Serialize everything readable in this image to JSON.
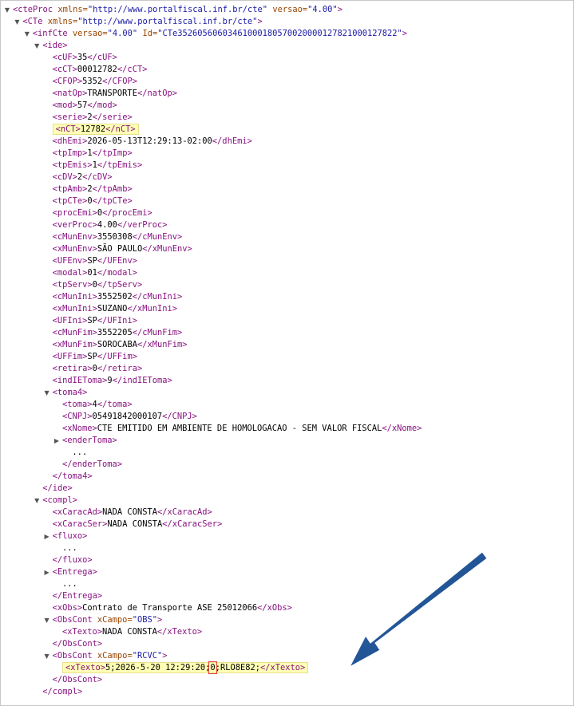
{
  "colors": {
    "tag": "#881280",
    "attr_name": "#994500",
    "attr_value": "#1a1aa6",
    "highlight": "#ffffb5",
    "red_box": "#e0403c",
    "arrow": "#1f4e8c"
  },
  "icons": {
    "expanded": "triangle-down-icon",
    "collapsed": "triangle-right-icon"
  },
  "lines": [
    {
      "depth": 0,
      "toggle": "expanded",
      "parts": [
        [
          "t",
          "<cteProc"
        ],
        [
          "s",
          " "
        ],
        [
          "a",
          "xmlns="
        ],
        [
          "v",
          "\"http://www.portalfiscal.inf.br/cte\""
        ],
        [
          "s",
          " "
        ],
        [
          "a",
          "versao="
        ],
        [
          "v",
          "\"4.00\""
        ],
        [
          "t",
          ">"
        ]
      ]
    },
    {
      "depth": 1,
      "toggle": "expanded",
      "parts": [
        [
          "t",
          "<CTe"
        ],
        [
          "s",
          " "
        ],
        [
          "a",
          "xmlns="
        ],
        [
          "v",
          "\"http://www.portalfiscal.inf.br/cte\""
        ],
        [
          "t",
          ">"
        ]
      ]
    },
    {
      "depth": 2,
      "toggle": "expanded",
      "parts": [
        [
          "t",
          "<infCte"
        ],
        [
          "s",
          " "
        ],
        [
          "a",
          "versao="
        ],
        [
          "v",
          "\"4.00\""
        ],
        [
          "s",
          " "
        ],
        [
          "a",
          "Id="
        ],
        [
          "v",
          "\"CTe35260560603461000180570020000127821000127822\""
        ],
        [
          "t",
          ">"
        ]
      ]
    },
    {
      "depth": 3,
      "toggle": "expanded",
      "parts": [
        [
          "t",
          "<ide>"
        ]
      ]
    },
    {
      "depth": 4,
      "parts": [
        [
          "t",
          "<cUF>"
        ],
        [
          "x",
          "35"
        ],
        [
          "t",
          "</cUF>"
        ]
      ]
    },
    {
      "depth": 4,
      "parts": [
        [
          "t",
          "<cCT>"
        ],
        [
          "x",
          "00012782"
        ],
        [
          "t",
          "</cCT>"
        ]
      ]
    },
    {
      "depth": 4,
      "parts": [
        [
          "t",
          "<CFOP>"
        ],
        [
          "x",
          "5352"
        ],
        [
          "t",
          "</CFOP>"
        ]
      ]
    },
    {
      "depth": 4,
      "parts": [
        [
          "t",
          "<natOp>"
        ],
        [
          "x",
          "TRANSPORTE"
        ],
        [
          "t",
          "</natOp>"
        ]
      ]
    },
    {
      "depth": 4,
      "parts": [
        [
          "t",
          "<mod>"
        ],
        [
          "x",
          "57"
        ],
        [
          "t",
          "</mod>"
        ]
      ]
    },
    {
      "depth": 4,
      "parts": [
        [
          "t",
          "<serie>"
        ],
        [
          "x",
          "2"
        ],
        [
          "t",
          "</serie>"
        ]
      ]
    },
    {
      "depth": 4,
      "highlight": true,
      "parts": [
        [
          "t",
          "<nCT>"
        ],
        [
          "x",
          "12782"
        ],
        [
          "t",
          "</nCT>"
        ]
      ]
    },
    {
      "depth": 4,
      "parts": [
        [
          "t",
          "<dhEmi>"
        ],
        [
          "x",
          "2026-05-13T12:29:13-02:00"
        ],
        [
          "t",
          "</dhEmi>"
        ]
      ]
    },
    {
      "depth": 4,
      "parts": [
        [
          "t",
          "<tpImp>"
        ],
        [
          "x",
          "1"
        ],
        [
          "t",
          "</tpImp>"
        ]
      ]
    },
    {
      "depth": 4,
      "parts": [
        [
          "t",
          "<tpEmis>"
        ],
        [
          "x",
          "1"
        ],
        [
          "t",
          "</tpEmis>"
        ]
      ]
    },
    {
      "depth": 4,
      "parts": [
        [
          "t",
          "<cDV>"
        ],
        [
          "x",
          "2"
        ],
        [
          "t",
          "</cDV>"
        ]
      ]
    },
    {
      "depth": 4,
      "parts": [
        [
          "t",
          "<tpAmb>"
        ],
        [
          "x",
          "2"
        ],
        [
          "t",
          "</tpAmb>"
        ]
      ]
    },
    {
      "depth": 4,
      "parts": [
        [
          "t",
          "<tpCTe>"
        ],
        [
          "x",
          "0"
        ],
        [
          "t",
          "</tpCTe>"
        ]
      ]
    },
    {
      "depth": 4,
      "parts": [
        [
          "t",
          "<procEmi>"
        ],
        [
          "x",
          "0"
        ],
        [
          "t",
          "</procEmi>"
        ]
      ]
    },
    {
      "depth": 4,
      "parts": [
        [
          "t",
          "<verProc>"
        ],
        [
          "x",
          "4.00"
        ],
        [
          "t",
          "</verProc>"
        ]
      ]
    },
    {
      "depth": 4,
      "parts": [
        [
          "t",
          "<cMunEnv>"
        ],
        [
          "x",
          "3550308"
        ],
        [
          "t",
          "</cMunEnv>"
        ]
      ]
    },
    {
      "depth": 4,
      "parts": [
        [
          "t",
          "<xMunEnv>"
        ],
        [
          "x",
          "SÃO PAULO"
        ],
        [
          "t",
          "</xMunEnv>"
        ]
      ]
    },
    {
      "depth": 4,
      "parts": [
        [
          "t",
          "<UFEnv>"
        ],
        [
          "x",
          "SP"
        ],
        [
          "t",
          "</UFEnv>"
        ]
      ]
    },
    {
      "depth": 4,
      "parts": [
        [
          "t",
          "<modal>"
        ],
        [
          "x",
          "01"
        ],
        [
          "t",
          "</modal>"
        ]
      ]
    },
    {
      "depth": 4,
      "parts": [
        [
          "t",
          "<tpServ>"
        ],
        [
          "x",
          "0"
        ],
        [
          "t",
          "</tpServ>"
        ]
      ]
    },
    {
      "depth": 4,
      "parts": [
        [
          "t",
          "<cMunIni>"
        ],
        [
          "x",
          "3552502"
        ],
        [
          "t",
          "</cMunIni>"
        ]
      ]
    },
    {
      "depth": 4,
      "parts": [
        [
          "t",
          "<xMunIni>"
        ],
        [
          "x",
          "SUZANO"
        ],
        [
          "t",
          "</xMunIni>"
        ]
      ]
    },
    {
      "depth": 4,
      "parts": [
        [
          "t",
          "<UFIni>"
        ],
        [
          "x",
          "SP"
        ],
        [
          "t",
          "</UFIni>"
        ]
      ]
    },
    {
      "depth": 4,
      "parts": [
        [
          "t",
          "<cMunFim>"
        ],
        [
          "x",
          "3552205"
        ],
        [
          "t",
          "</cMunFim>"
        ]
      ]
    },
    {
      "depth": 4,
      "parts": [
        [
          "t",
          "<xMunFim>"
        ],
        [
          "x",
          "SOROCABA"
        ],
        [
          "t",
          "</xMunFim>"
        ]
      ]
    },
    {
      "depth": 4,
      "parts": [
        [
          "t",
          "<UFFim>"
        ],
        [
          "x",
          "SP"
        ],
        [
          "t",
          "</UFFim>"
        ]
      ]
    },
    {
      "depth": 4,
      "parts": [
        [
          "t",
          "<retira>"
        ],
        [
          "x",
          "0"
        ],
        [
          "t",
          "</retira>"
        ]
      ]
    },
    {
      "depth": 4,
      "parts": [
        [
          "t",
          "<indIETomа>"
        ],
        [
          "x",
          "9"
        ],
        [
          "t",
          "</indIEToma>"
        ]
      ]
    },
    {
      "depth": 4,
      "toggle": "expanded",
      "parts": [
        [
          "t",
          "<toma4>"
        ]
      ]
    },
    {
      "depth": 5,
      "parts": [
        [
          "t",
          "<toma>"
        ],
        [
          "x",
          "4"
        ],
        [
          "t",
          "</toma>"
        ]
      ]
    },
    {
      "depth": 5,
      "parts": [
        [
          "t",
          "<CNPJ>"
        ],
        [
          "x",
          "05491842000107"
        ],
        [
          "t",
          "</CNPJ>"
        ]
      ]
    },
    {
      "depth": 5,
      "parts": [
        [
          "t",
          "<xNome>"
        ],
        [
          "x",
          "CTE EMITIDO EM AMBIENTE DE HOMOLOGACAO - SEM VALOR FISCAL"
        ],
        [
          "t",
          "</xNome>"
        ]
      ]
    },
    {
      "depth": 5,
      "toggle": "collapsed",
      "parts": [
        [
          "t",
          "<enderToma>"
        ]
      ]
    },
    {
      "depth": 6,
      "parts": [
        [
          "x",
          "..."
        ]
      ]
    },
    {
      "depth": 5,
      "parts": [
        [
          "t",
          "</enderToma>"
        ]
      ]
    },
    {
      "depth": 4,
      "parts": [
        [
          "t",
          "</toma4>"
        ]
      ]
    },
    {
      "depth": 3,
      "parts": [
        [
          "t",
          "</ide>"
        ]
      ]
    },
    {
      "depth": 3,
      "toggle": "expanded",
      "parts": [
        [
          "t",
          "<compl>"
        ]
      ]
    },
    {
      "depth": 4,
      "parts": [
        [
          "t",
          "<xCaracAd>"
        ],
        [
          "x",
          "NADA CONSTA"
        ],
        [
          "t",
          "</xCaracAd>"
        ]
      ]
    },
    {
      "depth": 4,
      "parts": [
        [
          "t",
          "<xCaracSer>"
        ],
        [
          "x",
          "NADA CONSTA"
        ],
        [
          "t",
          "</xCaracSer>"
        ]
      ]
    },
    {
      "depth": 4,
      "toggle": "collapsed",
      "parts": [
        [
          "t",
          "<fluxo>"
        ]
      ]
    },
    {
      "depth": 5,
      "parts": [
        [
          "x",
          "..."
        ]
      ]
    },
    {
      "depth": 4,
      "parts": [
        [
          "t",
          "</fluxo>"
        ]
      ]
    },
    {
      "depth": 4,
      "toggle": "collapsed",
      "parts": [
        [
          "t",
          "<Entrega>"
        ]
      ]
    },
    {
      "depth": 5,
      "parts": [
        [
          "x",
          "..."
        ]
      ]
    },
    {
      "depth": 4,
      "parts": [
        [
          "t",
          "</Entrega>"
        ]
      ]
    },
    {
      "depth": 4,
      "parts": [
        [
          "t",
          "<xObs>"
        ],
        [
          "x",
          "Contrato de Transporte ASE 25012066"
        ],
        [
          "t",
          "</xObs>"
        ]
      ]
    },
    {
      "depth": 4,
      "toggle": "expanded",
      "parts": [
        [
          "t",
          "<ObsCont"
        ],
        [
          "s",
          " "
        ],
        [
          "a",
          "xCampo="
        ],
        [
          "v",
          "\"OBS\""
        ],
        [
          "t",
          ">"
        ]
      ]
    },
    {
      "depth": 5,
      "parts": [
        [
          "t",
          "<xTexto>"
        ],
        [
          "x",
          "NADA CONSTA"
        ],
        [
          "t",
          "</xTexto>"
        ]
      ]
    },
    {
      "depth": 4,
      "parts": [
        [
          "t",
          "</ObsCont>"
        ]
      ]
    },
    {
      "depth": 4,
      "toggle": "expanded",
      "parts": [
        [
          "t",
          "<ObsCont"
        ],
        [
          "s",
          " "
        ],
        [
          "a",
          "xCampo="
        ],
        [
          "v",
          "\"RCVC\""
        ],
        [
          "t",
          ">"
        ]
      ]
    },
    {
      "depth": 5,
      "highlight": true,
      "parts": [
        [
          "t",
          "<xTexto>"
        ],
        [
          "x",
          "5;2026-5-20 12:29:20;"
        ],
        [
          "xr",
          "0"
        ],
        [
          "x",
          ";RLO8E82;"
        ],
        [
          "t",
          "</xTexto>"
        ]
      ]
    },
    {
      "depth": 4,
      "parts": [
        [
          "t",
          "</ObsCont>"
        ]
      ]
    },
    {
      "depth": 3,
      "parts": [
        [
          "t",
          "</compl>"
        ]
      ]
    }
  ]
}
